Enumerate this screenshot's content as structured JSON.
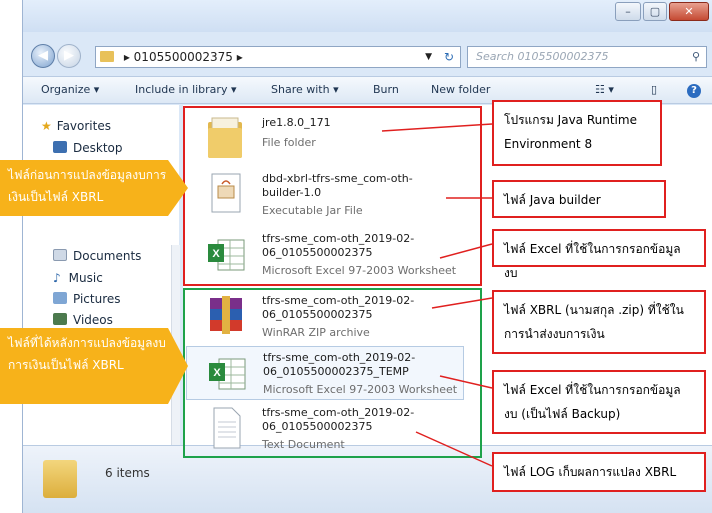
{
  "window": {
    "address_path": "0105500002375",
    "search_placeholder": "Search 0105500002375",
    "title_buttons": [
      "–",
      "▢",
      "✕"
    ]
  },
  "toolbar": {
    "organize": "Organize ▾",
    "include": "Include in library ▾",
    "share": "Share with ▾",
    "burn": "Burn",
    "new_folder": "New folder"
  },
  "sidebar": {
    "favorites": "Favorites",
    "desktop": "Desktop",
    "documents": "Documents",
    "music": "Music",
    "pictures": "Pictures",
    "videos": "Videos"
  },
  "files": [
    {
      "name": "jre1.8.0_171",
      "type": "File folder",
      "icon": "folder-icon"
    },
    {
      "name": "dbd-xbrl-tfrs-sme_com-oth-builder-1.0",
      "type": "Executable Jar File",
      "icon": "jar-icon"
    },
    {
      "name": "tfrs-sme_com-oth_2019-02-06_0105500002375",
      "type": "Microsoft Excel 97-2003 Worksheet",
      "icon": "excel-icon"
    },
    {
      "name": "tfrs-sme_com-oth_2019-02-06_0105500002375",
      "type": "WinRAR ZIP archive",
      "icon": "winrar-icon"
    },
    {
      "name": "tfrs-sme_com-oth_2019-02-06_0105500002375_TEMP",
      "type": "Microsoft Excel 97-2003 Worksheet",
      "icon": "excel-icon"
    },
    {
      "name": "tfrs-sme_com-oth_2019-02-06_0105500002375",
      "type": "Text Document",
      "icon": "text-doc-icon"
    }
  ],
  "status": {
    "items": "6 items"
  },
  "annotations": {
    "before_label": "ไฟล์ก่อนการแปลงข้อมูลงบการเงินเป็นไฟล์ XBRL",
    "after_label": "ไฟล์ที่ได้หลังการแปลงข้อมูลงบการเงินเป็นไฟล์ XBRL",
    "callout_java_runtime": "โปรแกรม Java Runtime Environment 8",
    "callout_java_builder": "ไฟล์ Java builder",
    "callout_excel": "ไฟล์ Excel ที่ใช้ในการกรอกข้อมูลงบ",
    "callout_xbrl": "ไฟล์ XBRL (นามสกุล .zip) ที่ใช้ในการนำส่งงบการเงิน",
    "callout_excel_backup": "ไฟล์ Excel ที่ใช้ในการกรอกข้อมูลงบ (เป็นไฟล์ Backup)",
    "callout_log": "ไฟล์ LOG เก็บผลการแปลง XBRL"
  }
}
